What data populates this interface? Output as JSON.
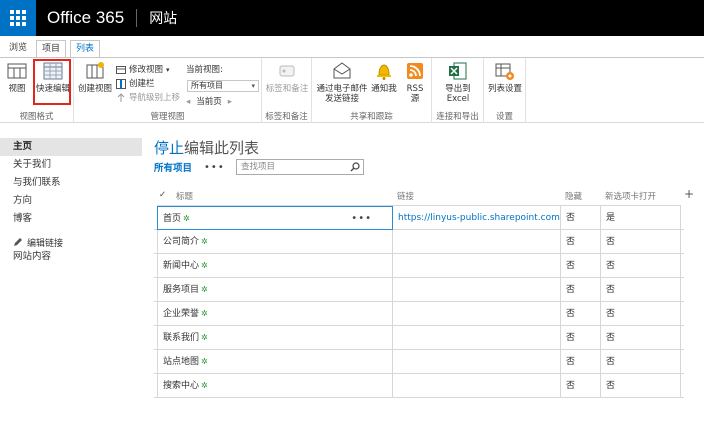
{
  "suite": {
    "brand": "Office 365",
    "site": "网站"
  },
  "tabs": [
    {
      "label": "浏览"
    },
    {
      "label": "项目"
    },
    {
      "label": "列表"
    }
  ],
  "ribbon": {
    "groups": {
      "view_format": "视图格式",
      "manage_views": "管理视图",
      "tags": "标签和备注",
      "share": "共享和跟踪",
      "connect": "连接和导出",
      "settings": "设置"
    },
    "buttons": {
      "view": "视图",
      "quick_edit": "快速编辑",
      "create_view": "创建视图",
      "modify_view": "修改视图",
      "create_column": "创建栏",
      "navigate_up": "导航级别上移",
      "current_view_label": "当前视图:",
      "current_view_value": "所有项目",
      "current_page": "当前页",
      "tags_notes": "标签和备注",
      "email_link": "通过电子邮件发送链接",
      "alert_me": "通知我",
      "rss": "RSS 源",
      "export_excel": "导出到 Excel",
      "list_settings": "列表设置"
    }
  },
  "leftnav": {
    "items": [
      {
        "label": "主页",
        "selected": true
      },
      {
        "label": "关于我们"
      },
      {
        "label": "与我们联系"
      },
      {
        "label": "方向"
      },
      {
        "label": "博客"
      }
    ],
    "edit_links": "编辑链接",
    "site_contents": "网站内容"
  },
  "main": {
    "title_accent": "停止",
    "title_rest": "编辑此列表",
    "view_name": "所有项目",
    "view_more": "•••",
    "search_placeholder": "查找项目",
    "columns": {
      "title": "标题",
      "link": "链接",
      "hidden": "隐藏",
      "new_tab": "新选项卡打开",
      "add": "+"
    },
    "rows": [
      {
        "title": "首页",
        "link": "https://linyus-public.sharepoint.com",
        "hidden": "否",
        "new_tab": "是"
      },
      {
        "title": "公司简介",
        "link": "",
        "hidden": "否",
        "new_tab": "否"
      },
      {
        "title": "新闻中心",
        "link": "",
        "hidden": "否",
        "new_tab": "否"
      },
      {
        "title": "服务项目",
        "link": "",
        "hidden": "否",
        "new_tab": "否"
      },
      {
        "title": "企业荣誉",
        "link": "",
        "hidden": "否",
        "new_tab": "否"
      },
      {
        "title": "联系我们",
        "link": "",
        "hidden": "否",
        "new_tab": "否"
      },
      {
        "title": "站点地图",
        "link": "",
        "hidden": "否",
        "new_tab": "否"
      },
      {
        "title": "搜索中心",
        "link": "",
        "hidden": "否",
        "new_tab": "否"
      }
    ],
    "new_marker": "✲",
    "row_more": "•••"
  }
}
